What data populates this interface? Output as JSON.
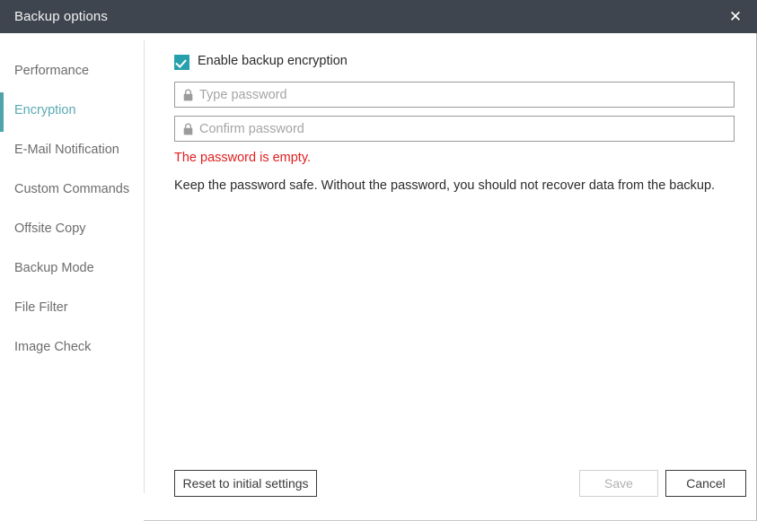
{
  "window": {
    "title": "Backup options",
    "close_icon": "close-icon",
    "close_glyph": "✕",
    "titlebar_color": "#3e454e",
    "accent_color": "#4fa3ab"
  },
  "sidebar": {
    "items": [
      {
        "label": "Performance",
        "active": false
      },
      {
        "label": "Encryption",
        "active": true
      },
      {
        "label": "E-Mail Notification",
        "active": false
      },
      {
        "label": "Custom Commands",
        "active": false
      },
      {
        "label": "Offsite Copy",
        "active": false
      },
      {
        "label": "Backup Mode",
        "active": false
      },
      {
        "label": "File Filter",
        "active": false
      },
      {
        "label": "Image Check",
        "active": false
      }
    ]
  },
  "main": {
    "enable_encryption": {
      "label": "Enable backup encryption",
      "checked": true,
      "color": "#27a0ad"
    },
    "password_field": {
      "placeholder": "Type password",
      "value": "",
      "icon": "lock-icon"
    },
    "confirm_field": {
      "placeholder": "Confirm password",
      "value": "",
      "icon": "lock-icon"
    },
    "error_message": "The password is empty.",
    "error_color": "#e02020",
    "hint_message": "Keep the password safe. Without the password, you should not recover data from the backup."
  },
  "footer": {
    "reset_label": "Reset to initial settings",
    "save_label": "Save",
    "save_disabled": true,
    "cancel_label": "Cancel"
  }
}
